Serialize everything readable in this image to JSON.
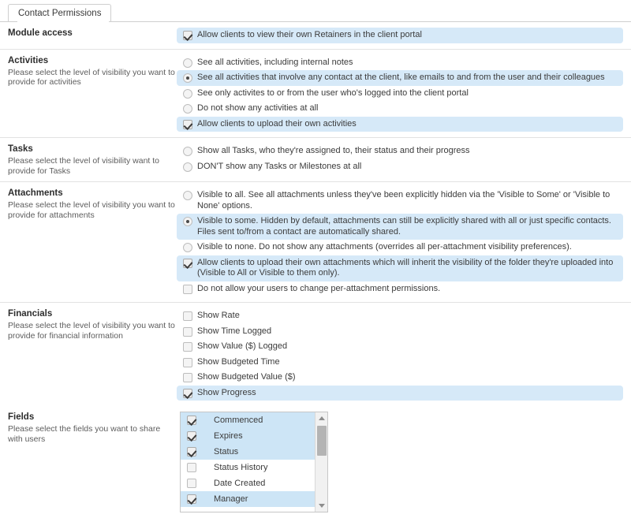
{
  "tab": {
    "label": "Contact Permissions"
  },
  "sections": [
    {
      "title": "Module access",
      "desc": "",
      "options": [
        {
          "control": "checkbox",
          "checked": true,
          "highlight": true,
          "text": "Allow clients to view their own Retainers in the client portal"
        }
      ]
    },
    {
      "title": "Activities",
      "desc": "Please select the level of visibility you want to provide for activities",
      "options": [
        {
          "control": "radio",
          "checked": false,
          "highlight": false,
          "text": "See all activities, including internal notes"
        },
        {
          "control": "radio",
          "checked": true,
          "highlight": true,
          "text": "See all activities that involve any contact at the client, like emails to and from the user and their colleagues"
        },
        {
          "control": "radio",
          "checked": false,
          "highlight": false,
          "text": "See only activites to or from the user who's logged into the client portal"
        },
        {
          "control": "radio",
          "checked": false,
          "highlight": false,
          "text": "Do not show any activities at all"
        },
        {
          "control": "checkbox",
          "checked": true,
          "highlight": true,
          "text": "Allow clients to upload their own activities"
        }
      ]
    },
    {
      "title": "Tasks",
      "desc": "Please select the level of visibility want to provide for Tasks",
      "options": [
        {
          "control": "radio",
          "checked": false,
          "highlight": false,
          "text": "Show all Tasks, who they're assigned to, their status and their progress"
        },
        {
          "control": "radio",
          "checked": false,
          "highlight": false,
          "text": "DON'T show any Tasks or Milestones at all"
        }
      ]
    },
    {
      "title": "Attachments",
      "desc": "Please select the level of visibility you want to provide for attachments",
      "options": [
        {
          "control": "radio",
          "checked": false,
          "highlight": false,
          "text": "Visible to all. See all attachments unless they've been explicitly hidden via the 'Visible to Some' or 'Visible to None' options."
        },
        {
          "control": "radio",
          "checked": true,
          "highlight": true,
          "text": "Visible to some. Hidden by default, attachments can still be explicitly shared with all or just specific contacts. Files sent to/from a contact are automatically shared."
        },
        {
          "control": "radio",
          "checked": false,
          "highlight": false,
          "text": "Visible to none. Do not show any attachments (overrides all per-attachment visibility preferences)."
        },
        {
          "control": "checkbox",
          "checked": true,
          "highlight": true,
          "text": "Allow clients to upload their own attachments which will inherit the visibility of the folder they're uploaded into (Visible to All or Visible to them only)."
        },
        {
          "control": "checkbox",
          "checked": false,
          "highlight": false,
          "text": "Do not allow your users to change per-attachment permissions."
        }
      ]
    },
    {
      "title": "Financials",
      "desc": "Please select the level of visibility you want to provide for financial information",
      "options": [
        {
          "control": "checkbox",
          "checked": false,
          "highlight": false,
          "text": "Show Rate"
        },
        {
          "control": "checkbox",
          "checked": false,
          "highlight": false,
          "text": "Show Time Logged"
        },
        {
          "control": "checkbox",
          "checked": false,
          "highlight": false,
          "text": "Show Value ($) Logged"
        },
        {
          "control": "checkbox",
          "checked": false,
          "highlight": false,
          "text": "Show Budgeted Time"
        },
        {
          "control": "checkbox",
          "checked": false,
          "highlight": false,
          "text": "Show Budgeted Value ($)"
        },
        {
          "control": "checkbox",
          "checked": true,
          "highlight": true,
          "text": "Show Progress"
        }
      ]
    }
  ],
  "fields": {
    "title": "Fields",
    "desc": "Please select the fields you want to share with users",
    "items": [
      {
        "label": "Commenced",
        "checked": true,
        "selected": true
      },
      {
        "label": "Expires",
        "checked": true,
        "selected": true
      },
      {
        "label": "Status",
        "checked": true,
        "selected": true
      },
      {
        "label": "Status History",
        "checked": false,
        "selected": false
      },
      {
        "label": "Date Created",
        "checked": false,
        "selected": false
      },
      {
        "label": "Manager",
        "checked": true,
        "selected": true
      }
    ],
    "scrollbar": {
      "up_icon": "triangle-up-icon",
      "down_icon": "triangle-down-icon"
    }
  },
  "colors": {
    "highlight": "#d6e9f8",
    "list_selected": "#cde5f6",
    "divider": "#e2e2e2",
    "border": "#c6c6c6"
  }
}
